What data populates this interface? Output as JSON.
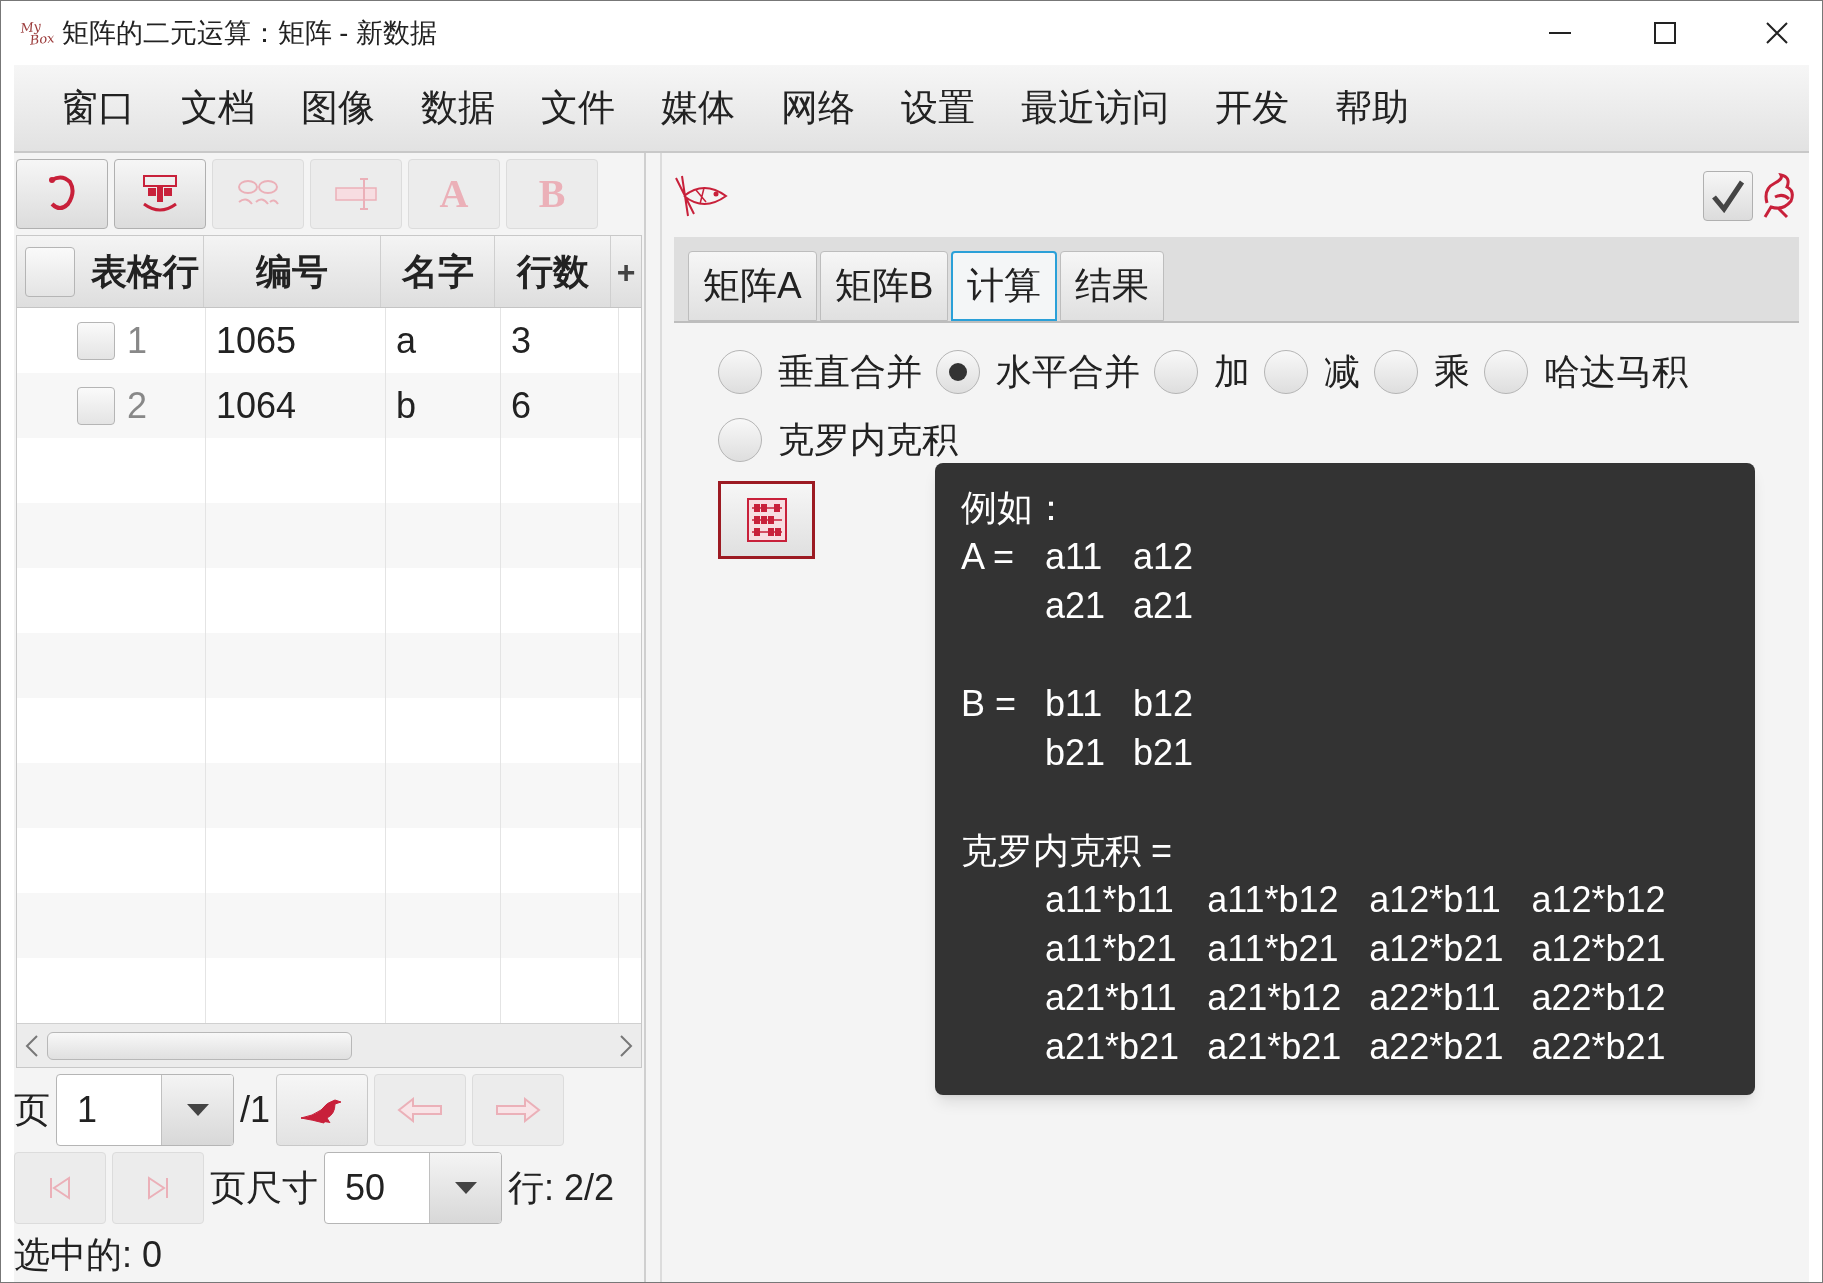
{
  "window": {
    "title": "矩阵的二元运算：矩阵 - 新数据",
    "logo": [
      "My",
      "Box"
    ]
  },
  "menu": [
    "窗口",
    "文档",
    "图像",
    "数据",
    "文件",
    "媒体",
    "网络",
    "设置",
    "最近访问",
    "开发",
    "帮助"
  ],
  "toolbar": [
    {
      "kind": "swirl",
      "disabled": false
    },
    {
      "kind": "mask",
      "disabled": false
    },
    {
      "kind": "pattern",
      "disabled": true
    },
    {
      "kind": "bar",
      "disabled": true
    },
    {
      "kind": "text",
      "label": "A",
      "disabled": true
    },
    {
      "kind": "text",
      "label": "B",
      "disabled": true
    }
  ],
  "table": {
    "all_checked": false,
    "columns": [
      "表格行",
      "编号",
      "名字",
      "行数"
    ],
    "add_column": "+",
    "rows": [
      {
        "checked": false,
        "cells": [
          "1",
          "1065",
          "a",
          "3"
        ]
      },
      {
        "checked": false,
        "cells": [
          "2",
          "1064",
          "b",
          "6"
        ]
      }
    ]
  },
  "pagination": {
    "page_label": "页",
    "page": "1",
    "page_total": "/1",
    "size_label": "页尺寸",
    "size": "50",
    "rows": "行: 2/2",
    "selected": "选中的: 0"
  },
  "tabs": [
    {
      "label": "矩阵A",
      "selected": false
    },
    {
      "label": "矩阵B",
      "selected": false
    },
    {
      "label": "计算",
      "selected": true
    },
    {
      "label": "结果",
      "selected": false
    }
  ],
  "operations": [
    {
      "label": "垂直合并",
      "selected": false
    },
    {
      "label": "水平合并",
      "selected": true
    },
    {
      "label": "加",
      "selected": false
    },
    {
      "label": "减",
      "selected": false
    },
    {
      "label": "乘",
      "selected": false
    },
    {
      "label": "哈达马积",
      "selected": false
    },
    {
      "label": "克罗内克积",
      "selected": false
    }
  ],
  "tooltip": {
    "intro": "例如：",
    "matrices": [
      {
        "kind": "inline",
        "label": "A =",
        "rows": [
          [
            "a11",
            "a12"
          ],
          [
            "a21",
            "a21"
          ]
        ]
      },
      {
        "kind": "inline",
        "label": "B =",
        "rows": [
          [
            "b11",
            "b12"
          ],
          [
            "b21",
            "b21"
          ]
        ]
      },
      {
        "kind": "below",
        "label": "克罗内克积 =",
        "rows": [
          [
            "a11*b11",
            "a11*b12",
            "a12*b11",
            "a12*b12"
          ],
          [
            "a11*b21",
            "a11*b21",
            "a12*b21",
            "a12*b21"
          ],
          [
            "a21*b11",
            "a21*b12",
            "a22*b11",
            "a22*b12"
          ],
          [
            "a21*b21",
            "a21*b21",
            "a22*b21",
            "a22*b21"
          ]
        ]
      }
    ]
  }
}
